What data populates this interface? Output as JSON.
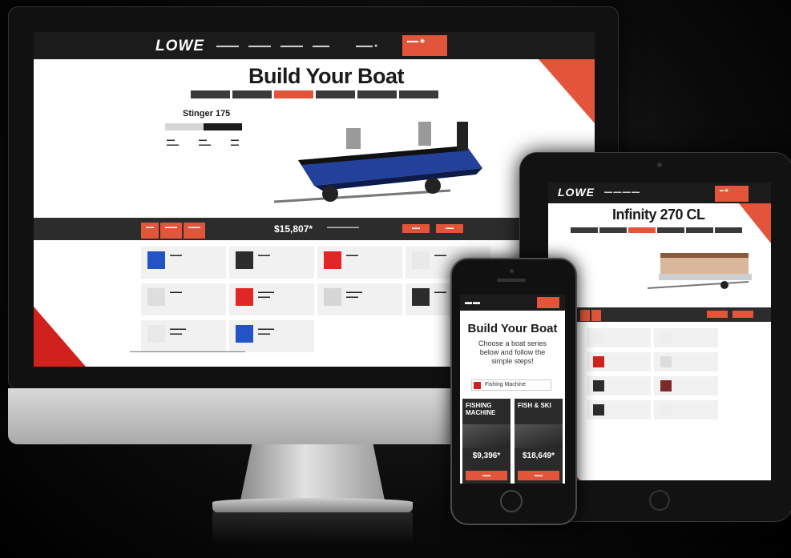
{
  "desktop": {
    "logo": "LOWE",
    "title": "Build Your Boat",
    "model": "Stinger 175",
    "price": "$15,807*"
  },
  "tablet": {
    "logo": "LOWE",
    "model": "Infinity 270 CL"
  },
  "phone": {
    "title": "Build Your Boat",
    "intro": "Choose a boat series below and follow the simple steps!",
    "selector": "Fishing Machine",
    "cards": [
      {
        "title": "FISHING MACHINE",
        "price": "$9,396*"
      },
      {
        "title": "FISH & SKI",
        "price": "$18,649*"
      }
    ]
  },
  "colors": {
    "accent": "#e2553a",
    "red": "#d0211c",
    "dark": "#1b1b1b",
    "hull_blue": "#23409a"
  }
}
